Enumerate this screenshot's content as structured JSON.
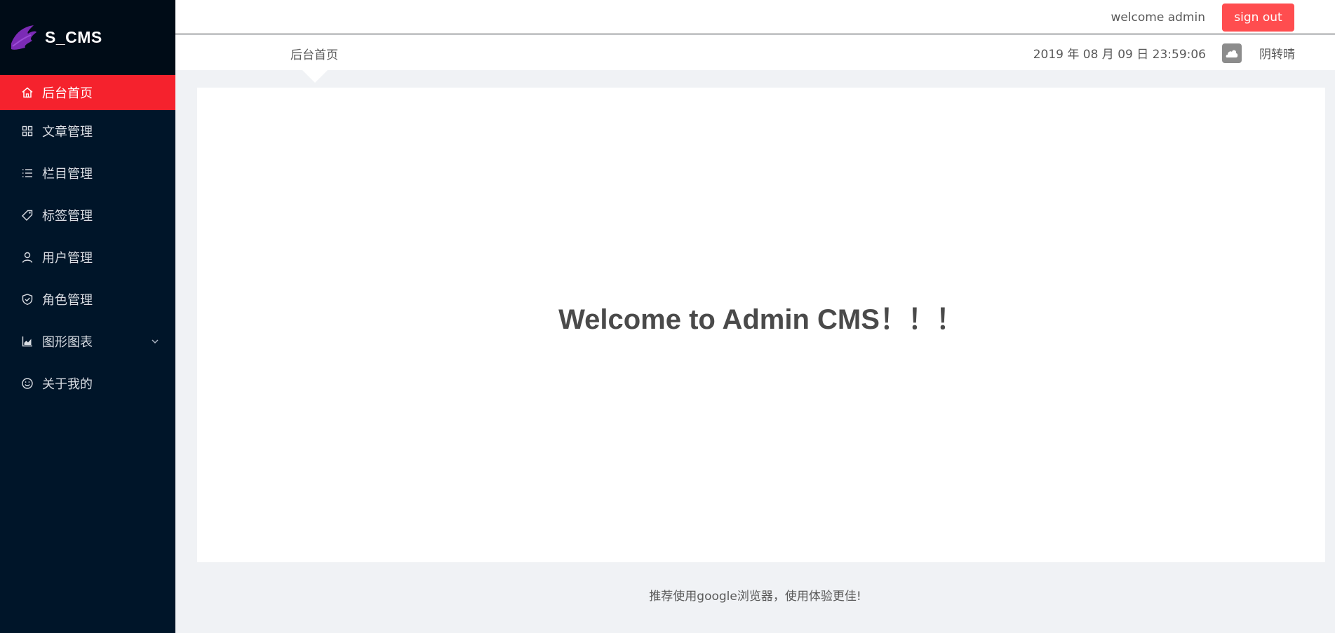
{
  "brand": {
    "name": "S_CMS"
  },
  "header": {
    "welcome": "welcome admin",
    "signout_label": "sign out"
  },
  "subbar": {
    "breadcrumb": "后台首页",
    "datetime": "2019 年 08 月 09 日 23:59:06",
    "weather_icon": "cloud-icon",
    "weather": "阴转晴"
  },
  "sidebar": {
    "items": [
      {
        "label": "后台首页",
        "icon": "home-icon",
        "active": true
      },
      {
        "label": "文章管理",
        "icon": "grid-icon"
      },
      {
        "label": "栏目管理",
        "icon": "list-icon"
      },
      {
        "label": "标签管理",
        "icon": "tag-icon"
      },
      {
        "label": "用户管理",
        "icon": "user-icon"
      },
      {
        "label": "角色管理",
        "icon": "shield-icon"
      },
      {
        "label": "图形图表",
        "icon": "chart-icon",
        "expandable": true
      },
      {
        "label": "关于我的",
        "icon": "smile-icon"
      }
    ]
  },
  "main": {
    "headline": "Welcome to Admin CMS！！！"
  },
  "footer": {
    "text": "推荐使用google浏览器，使用体验更佳!"
  },
  "colors": {
    "sidebar_bg": "#001529",
    "logo_bg": "#000c17",
    "accent": "#f5222d",
    "signout_bg": "#ff4d4f"
  }
}
